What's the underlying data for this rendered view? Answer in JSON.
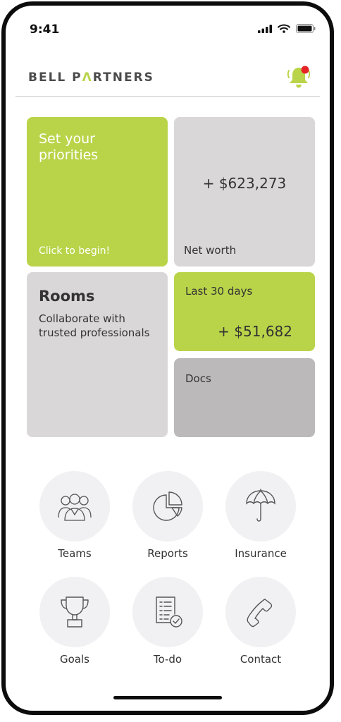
{
  "status": {
    "time": "9:41"
  },
  "header": {
    "brand_part1": "BELL P",
    "brand_mark": "Λ",
    "brand_part2": "RTNERS",
    "notification_icon": "bell-icon",
    "notification_dot_color": "#e62326"
  },
  "colors": {
    "accent_green": "#b9d449",
    "tile_grey": "#dad7d8",
    "tile_grey_dark": "#bcb9ba"
  },
  "tiles": {
    "priorities": {
      "title": "Set your priorities",
      "cta": "Click to begin!"
    },
    "net_worth": {
      "value": "+ $623,273",
      "label": "Net worth"
    },
    "rooms": {
      "title": "Rooms",
      "description": "Collaborate with trusted professionals"
    },
    "last_30_days": {
      "label": "Last 30 days",
      "value": "+ $51,682"
    },
    "docs": {
      "label": "Docs"
    }
  },
  "shortcuts": [
    {
      "label": "Teams",
      "icon": "teams-icon"
    },
    {
      "label": "Reports",
      "icon": "pie-chart-icon"
    },
    {
      "label": "Insurance",
      "icon": "umbrella-icon"
    },
    {
      "label": "Goals",
      "icon": "trophy-icon"
    },
    {
      "label": "To-do",
      "icon": "checklist-icon"
    },
    {
      "label": "Contact",
      "icon": "phone-icon"
    }
  ]
}
